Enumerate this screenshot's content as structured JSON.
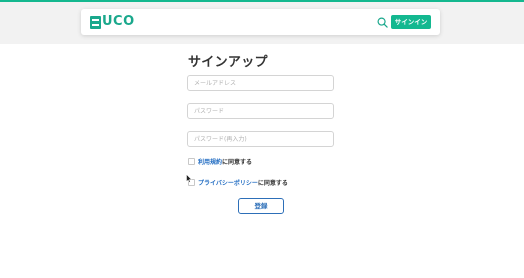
{
  "header": {
    "logo_text": "UCO",
    "signup_label": "サインイン"
  },
  "form": {
    "title": "サインアップ",
    "email_placeholder": "メールアドレス",
    "password_placeholder": "パスワード",
    "password_confirm_placeholder": "パスワード(再入力)",
    "terms_link": "利用規約",
    "terms_suffix": "に同意する",
    "privacy_link": "プライバシーポリシー",
    "privacy_suffix": "に同意する",
    "register_label": "登録"
  },
  "colors": {
    "brand": "#13b890",
    "link": "#1f6bc2",
    "register_border": "#2d6fb8"
  },
  "icons": {
    "loader": "loading-spinner-icon",
    "search": "search-icon",
    "logo": "logo-mark-icon",
    "cursor": "mouse-pointer-icon"
  }
}
